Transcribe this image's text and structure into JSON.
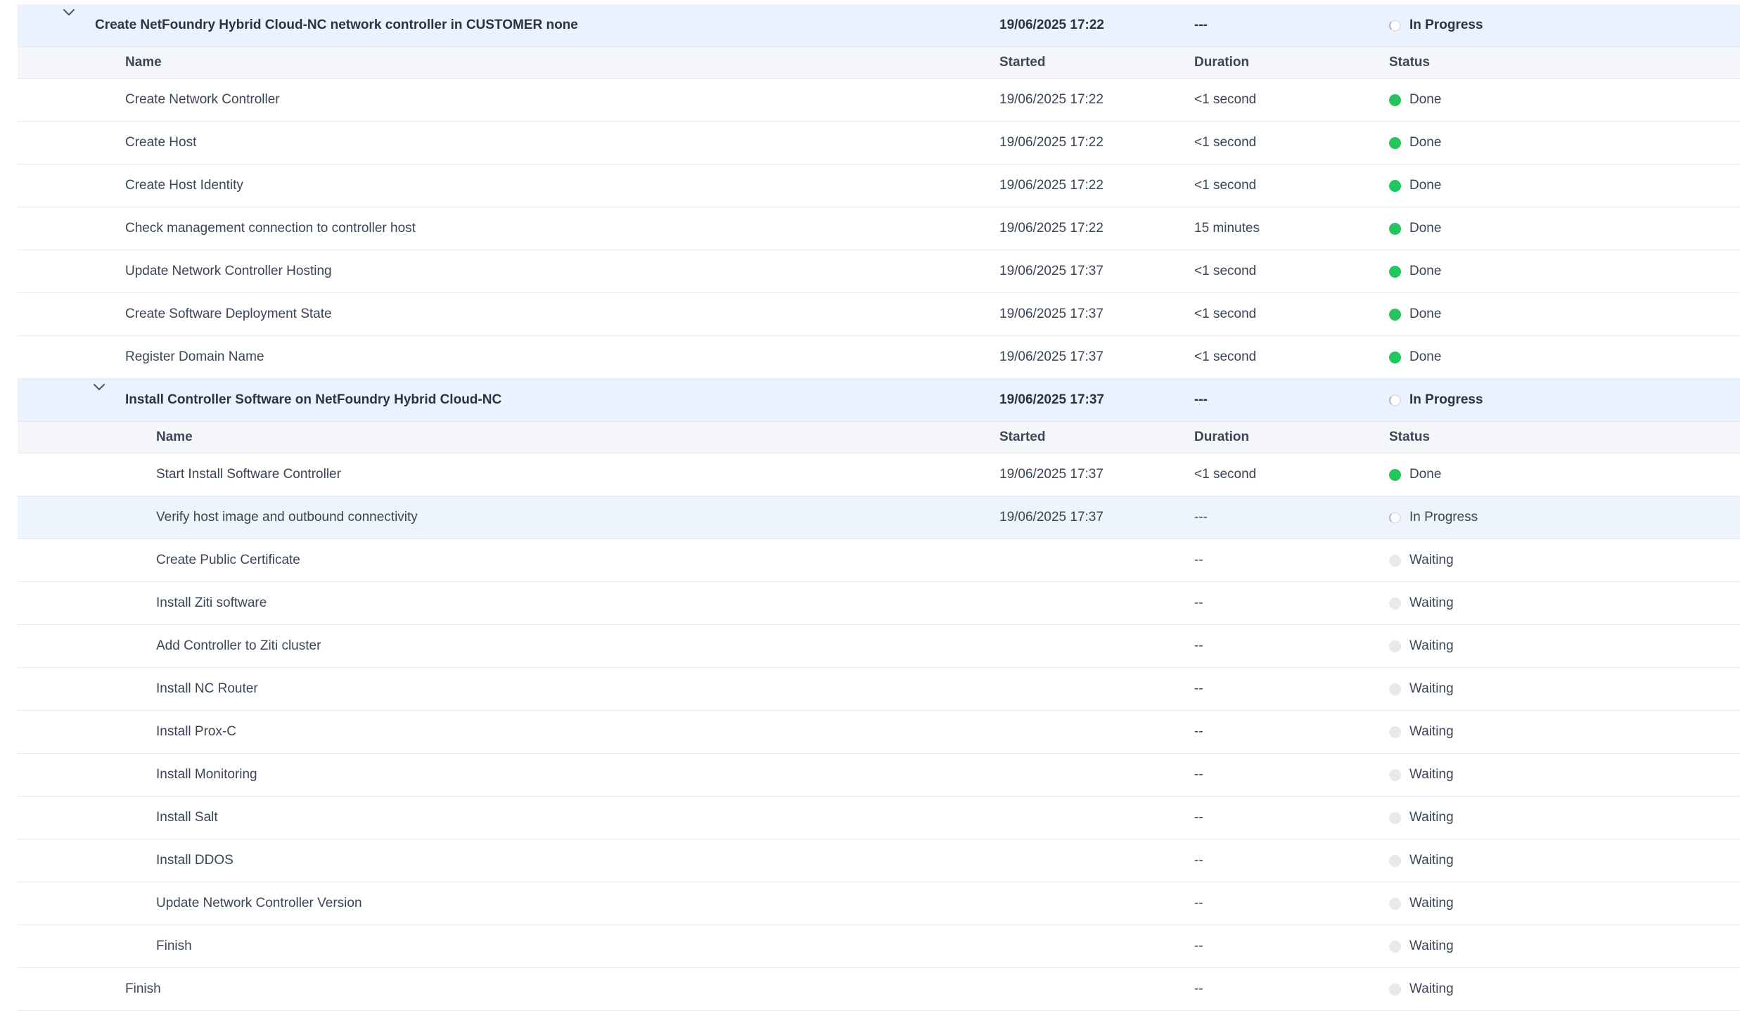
{
  "columns": {
    "name": "Name",
    "started": "Started",
    "duration": "Duration",
    "status": "Status"
  },
  "colors": {
    "group_background": "#eaf2fd",
    "header_background": "#f4f6f9",
    "done": "#22c55e",
    "waiting": "#e7e9ec"
  },
  "rows": [
    {
      "kind": "group",
      "level": 0,
      "expanded": true,
      "name": "Create NetFoundry Hybrid Cloud-NC network controller in CUSTOMER none",
      "started": "19/06/2025 17:22",
      "duration": "---",
      "status": "In Progress",
      "state": "progress"
    },
    {
      "kind": "header",
      "level": 1
    },
    {
      "kind": "task",
      "level": 1,
      "name": "Create Network Controller",
      "started": "19/06/2025 17:22",
      "duration": "<1 second",
      "status": "Done",
      "state": "done"
    },
    {
      "kind": "task",
      "level": 1,
      "name": "Create Host",
      "started": "19/06/2025 17:22",
      "duration": "<1 second",
      "status": "Done",
      "state": "done"
    },
    {
      "kind": "task",
      "level": 1,
      "name": "Create Host Identity",
      "started": "19/06/2025 17:22",
      "duration": "<1 second",
      "status": "Done",
      "state": "done"
    },
    {
      "kind": "task",
      "level": 1,
      "name": "Check management connection to controller host",
      "started": "19/06/2025 17:22",
      "duration": "15 minutes",
      "status": "Done",
      "state": "done"
    },
    {
      "kind": "task",
      "level": 1,
      "name": "Update Network Controller Hosting",
      "started": "19/06/2025 17:37",
      "duration": "<1 second",
      "status": "Done",
      "state": "done"
    },
    {
      "kind": "task",
      "level": 1,
      "name": "Create Software Deployment State",
      "started": "19/06/2025 17:37",
      "duration": "<1 second",
      "status": "Done",
      "state": "done"
    },
    {
      "kind": "task",
      "level": 1,
      "name": "Register Domain Name",
      "started": "19/06/2025 17:37",
      "duration": "<1 second",
      "status": "Done",
      "state": "done"
    },
    {
      "kind": "group",
      "level": 1,
      "expanded": true,
      "name": "Install Controller Software on NetFoundry Hybrid Cloud-NC",
      "started": "19/06/2025 17:37",
      "duration": "---",
      "status": "In Progress",
      "state": "progress"
    },
    {
      "kind": "header",
      "level": 2
    },
    {
      "kind": "task",
      "level": 2,
      "name": "Start Install Software Controller",
      "started": "19/06/2025 17:37",
      "duration": "<1 second",
      "status": "Done",
      "state": "done"
    },
    {
      "kind": "task",
      "level": 2,
      "name": "Verify host image and outbound connectivity",
      "started": "19/06/2025 17:37",
      "duration": "---",
      "status": "In Progress",
      "state": "progress",
      "active": true
    },
    {
      "kind": "task",
      "level": 2,
      "name": "Create Public Certificate",
      "started": "",
      "duration": "--",
      "status": "Waiting",
      "state": "waiting"
    },
    {
      "kind": "task",
      "level": 2,
      "name": "Install Ziti software",
      "started": "",
      "duration": "--",
      "status": "Waiting",
      "state": "waiting"
    },
    {
      "kind": "task",
      "level": 2,
      "name": "Add Controller to Ziti cluster",
      "started": "",
      "duration": "--",
      "status": "Waiting",
      "state": "waiting"
    },
    {
      "kind": "task",
      "level": 2,
      "name": "Install NC Router",
      "started": "",
      "duration": "--",
      "status": "Waiting",
      "state": "waiting"
    },
    {
      "kind": "task",
      "level": 2,
      "name": "Install Prox-C",
      "started": "",
      "duration": "--",
      "status": "Waiting",
      "state": "waiting"
    },
    {
      "kind": "task",
      "level": 2,
      "name": "Install Monitoring",
      "started": "",
      "duration": "--",
      "status": "Waiting",
      "state": "waiting"
    },
    {
      "kind": "task",
      "level": 2,
      "name": "Install Salt",
      "started": "",
      "duration": "--",
      "status": "Waiting",
      "state": "waiting"
    },
    {
      "kind": "task",
      "level": 2,
      "name": "Install DDOS",
      "started": "",
      "duration": "--",
      "status": "Waiting",
      "state": "waiting"
    },
    {
      "kind": "task",
      "level": 2,
      "name": "Update Network Controller Version",
      "started": "",
      "duration": "--",
      "status": "Waiting",
      "state": "waiting"
    },
    {
      "kind": "task",
      "level": 2,
      "name": "Finish",
      "started": "",
      "duration": "--",
      "status": "Waiting",
      "state": "waiting"
    },
    {
      "kind": "task",
      "level": 1,
      "name": "Finish",
      "started": "",
      "duration": "--",
      "status": "Waiting",
      "state": "waiting"
    }
  ]
}
